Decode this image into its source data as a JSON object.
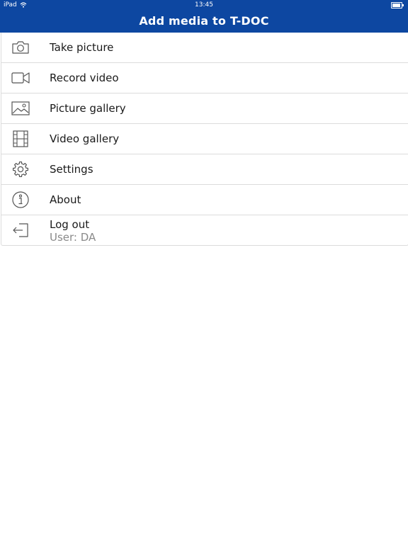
{
  "status_bar": {
    "device": "iPad",
    "time": "13:45",
    "battery_level": 0.9
  },
  "nav": {
    "title": "Add media to T-DOC",
    "background_color": "#0d47a1"
  },
  "menu": {
    "items": [
      {
        "label": "Take picture",
        "icon": "camera-icon"
      },
      {
        "label": "Record video",
        "icon": "video-camera-icon"
      },
      {
        "label": "Picture gallery",
        "icon": "image-icon"
      },
      {
        "label": "Video gallery",
        "icon": "film-icon"
      },
      {
        "label": "Settings",
        "icon": "gear-icon"
      },
      {
        "label": "About",
        "icon": "info-icon"
      },
      {
        "label": "Log out",
        "sublabel": "User: DA",
        "icon": "logout-icon"
      }
    ]
  }
}
